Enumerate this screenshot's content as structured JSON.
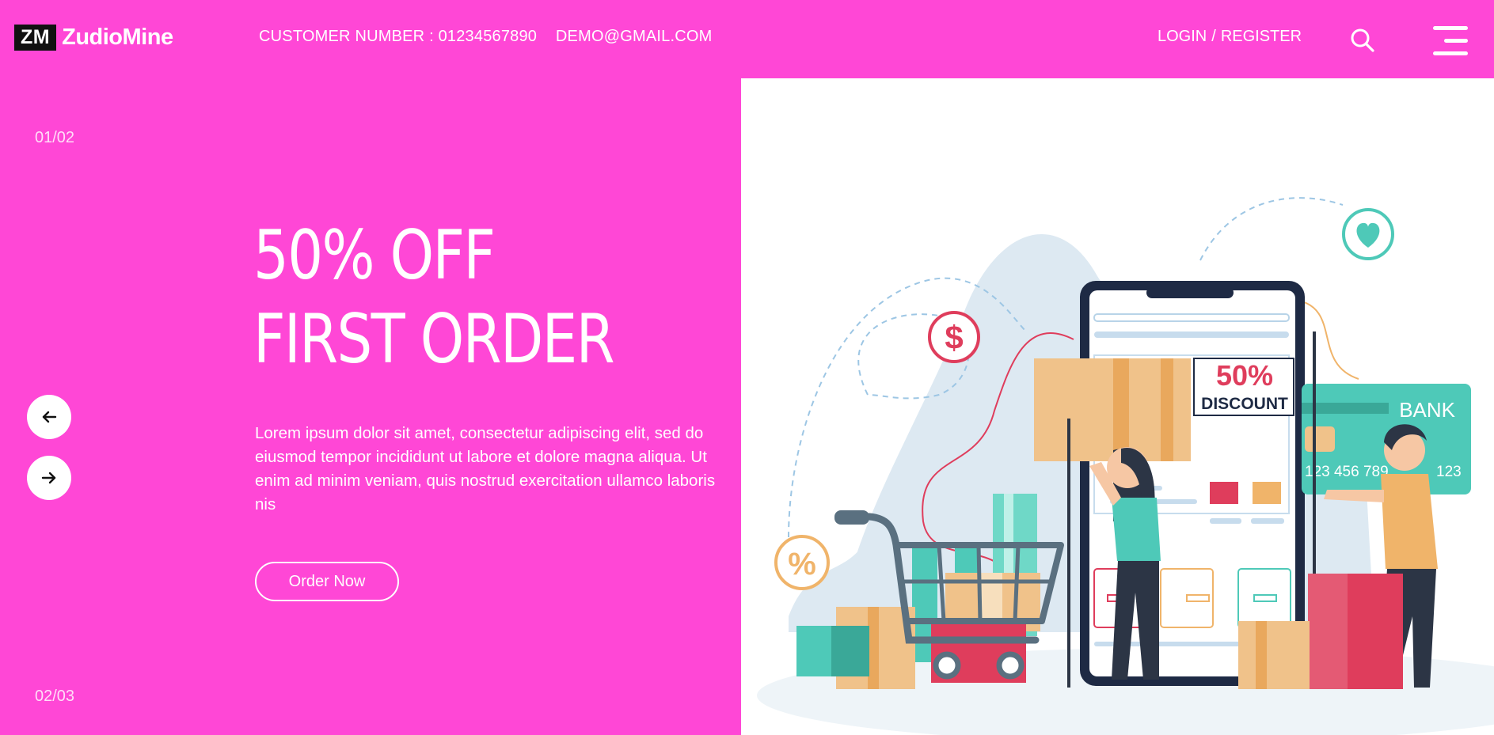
{
  "header": {
    "logo_badge": "ZM",
    "brand_name": "ZudioMine",
    "customer_number": "CUSTOMER NUMBER : 01234567890",
    "email": "DEMO@GMAIL.COM",
    "login": "LOGIN",
    "separator": "/",
    "register": "REGISTER",
    "search_icon": "search-icon",
    "menu_icon": "hamburger-menu-icon"
  },
  "slider": {
    "counter_top": "01/02",
    "counter_bottom": "02/03",
    "prev_icon": "arrow-left-icon",
    "next_icon": "arrow-right-icon"
  },
  "hero": {
    "headline_line1": "50% OFF",
    "headline_line2": "FIRST ORDER",
    "description": "Lorem ipsum dolor sit amet, consectetur adipiscing elit, sed do eiusmod tempor incididunt ut labore et dolore magna aliqua. Ut enim ad minim veniam, quis nostrud exercitation ullamco laboris nis",
    "cta_label": "Order Now"
  },
  "illustration": {
    "discount_percent": "50%",
    "discount_word": "DISCOUNT",
    "card_bank": "BANK",
    "card_number": "123 456 789",
    "card_number_end": "123"
  },
  "colors": {
    "accent": "#ff47d6",
    "teal": "#4ec9b8",
    "orange": "#f0b46a",
    "red": "#df3d5c",
    "navy": "#1e2a44"
  }
}
